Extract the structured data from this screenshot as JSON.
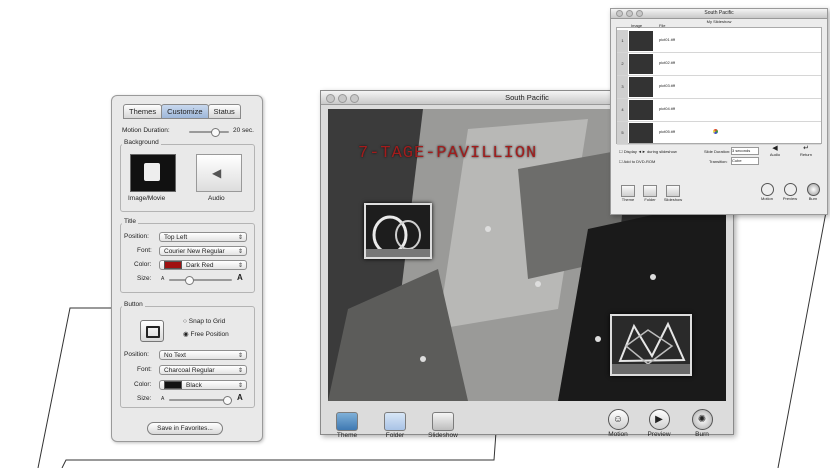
{
  "inspector": {
    "tabs": [
      "Themes",
      "Customize",
      "Status"
    ],
    "active_tab": "Customize",
    "motion_duration_label": "Motion Duration:",
    "motion_duration_value": "20 sec.",
    "background_group": "Background",
    "image_movie_label": "Image/Movie",
    "audio_label": "Audio",
    "title_group": "Title",
    "position_label": "Position:",
    "title_position": "Top Left",
    "font_label": "Font:",
    "title_font": "Courier New Regular",
    "color_label": "Color:",
    "title_color": "Dark Red",
    "title_color_hex": "#a01010",
    "size_label": "Size:",
    "size_small": "A",
    "size_large": "A",
    "button_group": "Button",
    "snap_to_grid": "Snap to Grid",
    "free_position": "Free Position",
    "button_position": "No Text",
    "button_font": "Charcoal Regular",
    "button_color": "Black",
    "button_color_hex": "#111111",
    "save_favorites": "Save in Favorites..."
  },
  "main_window": {
    "title": "South Pacific",
    "menu_title": "7-TAGE-PAVILLION",
    "toolbar": {
      "theme": "Theme",
      "folder": "Folder",
      "slideshow": "Slideshow",
      "motion": "Motion",
      "preview": "Preview",
      "burn": "Burn"
    }
  },
  "small_window": {
    "title": "South Pacific",
    "subtitle": "My Slideshow",
    "col_image": "Image",
    "col_file": "File",
    "rows": [
      {
        "num": "1",
        "file": "pict01.tiff"
      },
      {
        "num": "2",
        "file": "pict02.tiff"
      },
      {
        "num": "3",
        "file": "pict03.tiff"
      },
      {
        "num": "4",
        "file": "pict04.tiff"
      },
      {
        "num": "5",
        "file": "pict05.tiff"
      }
    ],
    "display_arrows": "Display ◄► during slideshow",
    "add_to_dvd": "Add to DVD-ROM",
    "slide_duration_label": "Slide Duration:",
    "slide_duration_value": "3 seconds",
    "transition_label": "Transition:",
    "transition_value": "Cube",
    "audio_label": "Audio",
    "return_label": "Return",
    "toolbar": {
      "theme": "Theme",
      "folder": "Folder",
      "slideshow": "Slideshow",
      "motion": "Motion",
      "preview": "Preview",
      "burn": "Burn"
    }
  }
}
